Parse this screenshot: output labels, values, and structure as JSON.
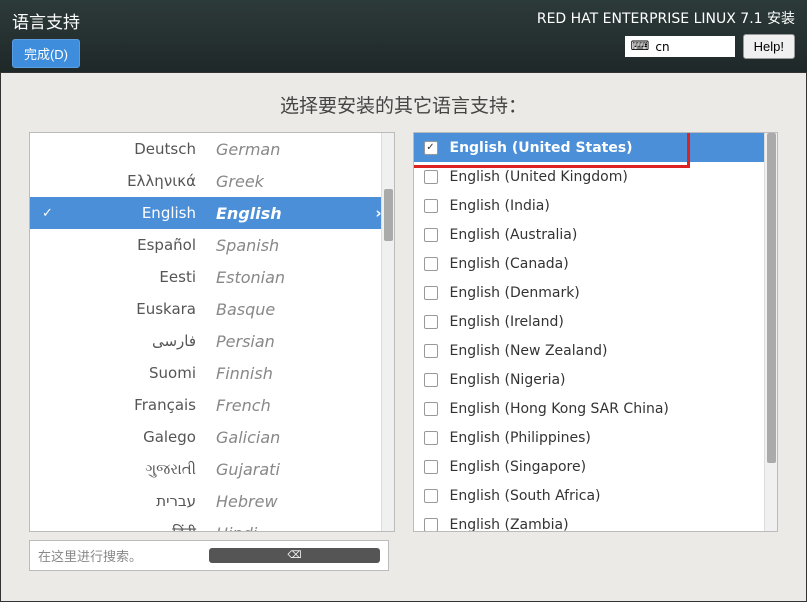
{
  "header": {
    "title": "语言支持",
    "done_label": "完成(D)",
    "subtitle": "RED HAT ENTERPRISE LINUX 7.1 安装",
    "keyboard_layout": "cn",
    "help_label": "Help!"
  },
  "main": {
    "page_title": "选择要安装的其它语言支持：",
    "search_placeholder": "在这里进行搜索。"
  },
  "languages": [
    {
      "native": "Deutsch",
      "english": "German",
      "selected": false
    },
    {
      "native": "Ελληνικά",
      "english": "Greek",
      "selected": false
    },
    {
      "native": "English",
      "english": "English",
      "selected": true
    },
    {
      "native": "Español",
      "english": "Spanish",
      "selected": false
    },
    {
      "native": "Eesti",
      "english": "Estonian",
      "selected": false
    },
    {
      "native": "Euskara",
      "english": "Basque",
      "selected": false
    },
    {
      "native": "فارسی",
      "english": "Persian",
      "selected": false
    },
    {
      "native": "Suomi",
      "english": "Finnish",
      "selected": false
    },
    {
      "native": "Français",
      "english": "French",
      "selected": false
    },
    {
      "native": "Galego",
      "english": "Galician",
      "selected": false
    },
    {
      "native": "ગુજરાતી",
      "english": "Gujarati",
      "selected": false
    },
    {
      "native": "עברית",
      "english": "Hebrew",
      "selected": false
    },
    {
      "native": "हिंदी",
      "english": "Hindi",
      "selected": false
    }
  ],
  "locales": [
    {
      "label": "English (United States)",
      "checked": true,
      "highlighted": true
    },
    {
      "label": "English (United Kingdom)",
      "checked": false,
      "highlighted": false
    },
    {
      "label": "English (India)",
      "checked": false,
      "highlighted": false
    },
    {
      "label": "English (Australia)",
      "checked": false,
      "highlighted": false
    },
    {
      "label": "English (Canada)",
      "checked": false,
      "highlighted": false
    },
    {
      "label": "English (Denmark)",
      "checked": false,
      "highlighted": false
    },
    {
      "label": "English (Ireland)",
      "checked": false,
      "highlighted": false
    },
    {
      "label": "English (New Zealand)",
      "checked": false,
      "highlighted": false
    },
    {
      "label": "English (Nigeria)",
      "checked": false,
      "highlighted": false
    },
    {
      "label": "English (Hong Kong SAR China)",
      "checked": false,
      "highlighted": false
    },
    {
      "label": "English (Philippines)",
      "checked": false,
      "highlighted": false
    },
    {
      "label": "English (Singapore)",
      "checked": false,
      "highlighted": false
    },
    {
      "label": "English (South Africa)",
      "checked": false,
      "highlighted": false
    },
    {
      "label": "English (Zambia)",
      "checked": false,
      "highlighted": false
    }
  ]
}
